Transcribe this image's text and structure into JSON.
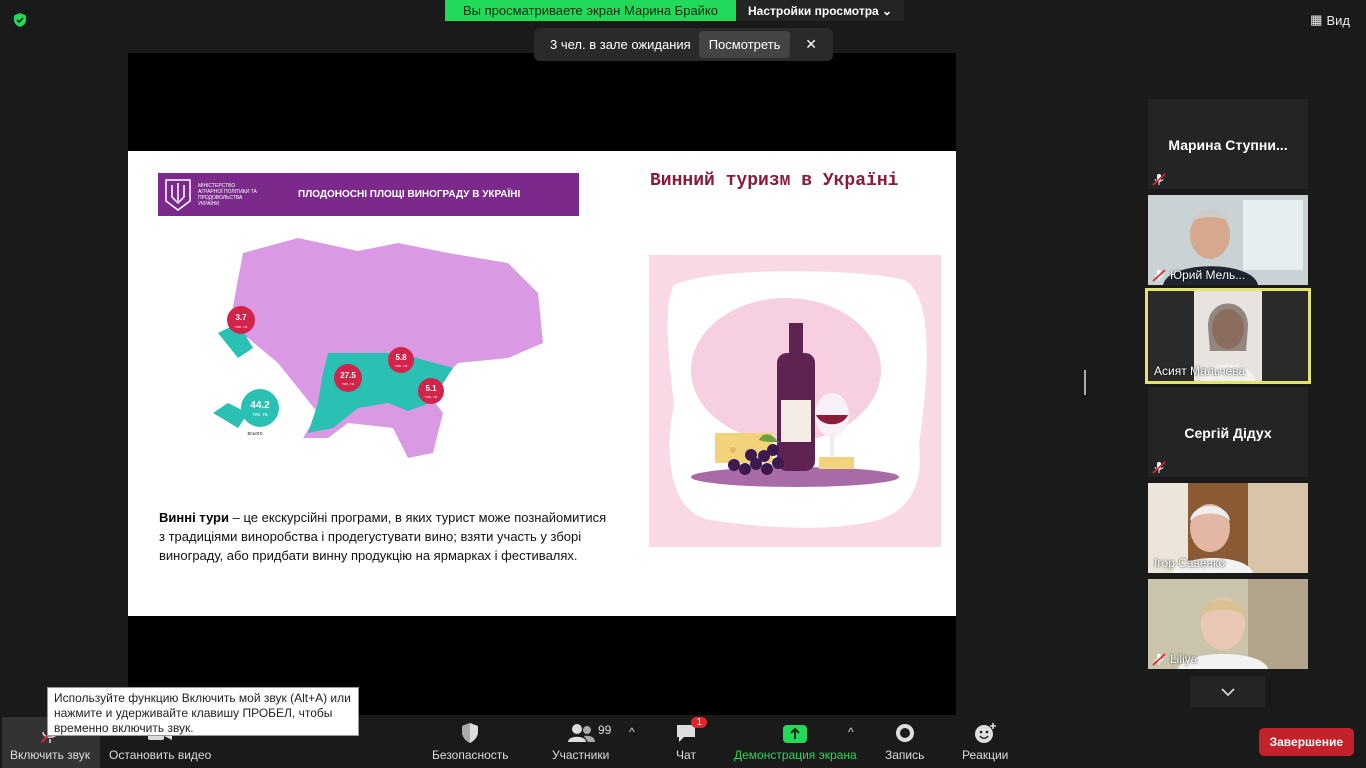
{
  "banner": {
    "sharing_text": "Вы просматриваете экран Марина Брайко",
    "view_settings": "Настройки просмотра"
  },
  "view_label": "Вид",
  "waiting_room": {
    "text": "3 чел. в зале ожидания",
    "view_button": "Посмотреть",
    "close": "✕"
  },
  "slide": {
    "header_title": "ПЛОДОНОСНІ ПЛОЩІ ВИНОГРАДУ В УКРАЇНІ",
    "ministry": "Міністерство аграрної політики та продовольства України",
    "title": "Винний туризм в Україні",
    "text_bold": "Винні тури",
    "text_rest": " – це екскурсійні програми, в яких турист може познайомитися з традиціями виноробства і продегустувати вино; взяти участь у зборі винограду, або придбати винну продукцію на ярмарках і фестивалях.",
    "map_values": [
      {
        "value": "3.7",
        "unit": "тис. га"
      },
      {
        "value": "5.8",
        "unit": "тис. га"
      },
      {
        "value": "27.5",
        "unit": "тис. га"
      },
      {
        "value": "5.1",
        "unit": "тис. га"
      },
      {
        "value": "44.2",
        "unit": "тис. га"
      }
    ],
    "total_label": "всього"
  },
  "participants": [
    {
      "name": "Марина  Ступни...",
      "video": false,
      "muted": true
    },
    {
      "name": "Юрий Мель...",
      "video": true,
      "muted": true
    },
    {
      "name": "Асият Мальчева",
      "video": true,
      "muted": false,
      "active": true
    },
    {
      "name": "Сергій Дідух",
      "video": false,
      "muted": true
    },
    {
      "name": "Ігор Савенко",
      "video": true,
      "muted": false
    },
    {
      "name": "Liliya",
      "video": true,
      "muted": true
    }
  ],
  "tooltip": "Используйте функцию Включить мой звук (Alt+A) или нажмите и удерживайте клавишу ПРОБЕЛ, чтобы временно включить звук.",
  "toolbar": {
    "unmute": "Включить звук",
    "stop_video": "Остановить видео",
    "security": "Безопасность",
    "participants": "Участники",
    "participants_count": "99",
    "chat": "Чат",
    "chat_badge": "1",
    "share": "Демонстрация экрана",
    "record": "Запись",
    "reactions": "Реакции",
    "end": "Завершение"
  },
  "colors": {
    "share_green": "#23d959",
    "end_red": "#c3212b",
    "slide_purple": "#7b2a8c",
    "active_border": "#e2e36d"
  }
}
